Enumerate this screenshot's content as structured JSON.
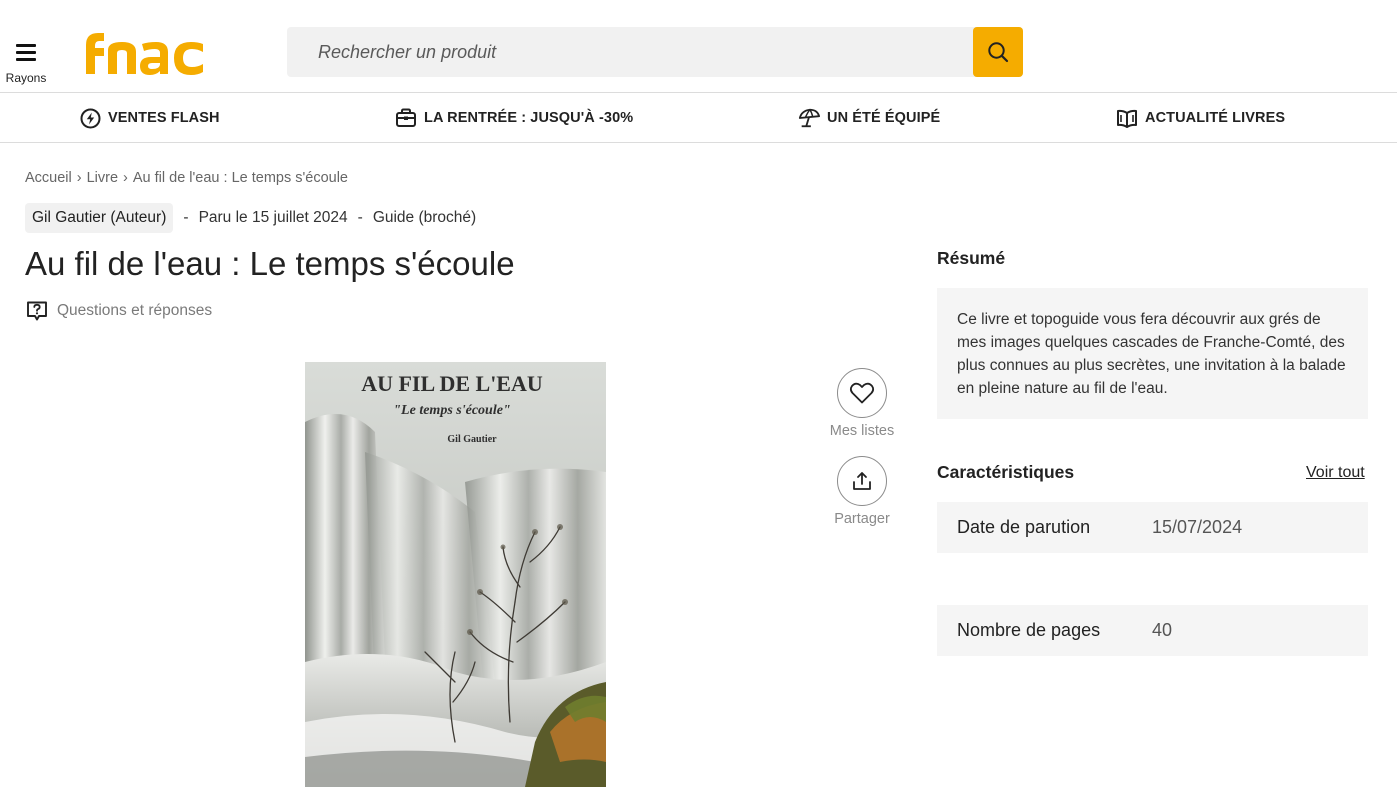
{
  "header": {
    "menu_label": "Rayons",
    "brand": "fnac",
    "search_placeholder": "Rechercher un produit"
  },
  "nav": [
    {
      "label": "VENTES FLASH",
      "icon": "lightning-icon"
    },
    {
      "label": "LA RENTRÉE : JUSQU'À -30%",
      "icon": "schoolbag-icon"
    },
    {
      "label": "UN ÉTÉ ÉQUIPÉ",
      "icon": "beach-umbrella-icon"
    },
    {
      "label": "ACTUALITÉ LIVRES",
      "icon": "open-book-icon"
    }
  ],
  "breadcrumb": [
    "Accueil",
    "Livre",
    "Au fil de l'eau : Le temps s'écoule"
  ],
  "product": {
    "author": "Gil Gautier (Auteur)",
    "release": "Paru le 15 juillet 2024",
    "format": "Guide (broché)",
    "title": "Au fil de l'eau : Le temps s'écoule",
    "qa_label": "Questions et réponses",
    "cover": {
      "title": "AU FIL DE L'EAU",
      "subtitle": "\"Le temps s'écoule\"",
      "author": "Gil Gautier"
    }
  },
  "actions": {
    "lists_label": "Mes listes",
    "share_label": "Partager"
  },
  "summary": {
    "heading": "Résumé",
    "text": "Ce livre et topoguide vous fera découvrir aux grés de mes images quelques cascades de Franche-Comté, des plus connues au plus secrètes, une invitation à la balade en pleine nature au fil de l'eau."
  },
  "specs": {
    "heading": "Caractéristiques",
    "see_all": "Voir tout",
    "rows": [
      {
        "key": "Date de parution",
        "value": "15/07/2024"
      },
      {
        "key": "Nombre de pages",
        "value": "40"
      }
    ]
  },
  "colors": {
    "brand": "#f5ac00",
    "text": "#222222",
    "panel": "#f5f5f5"
  }
}
